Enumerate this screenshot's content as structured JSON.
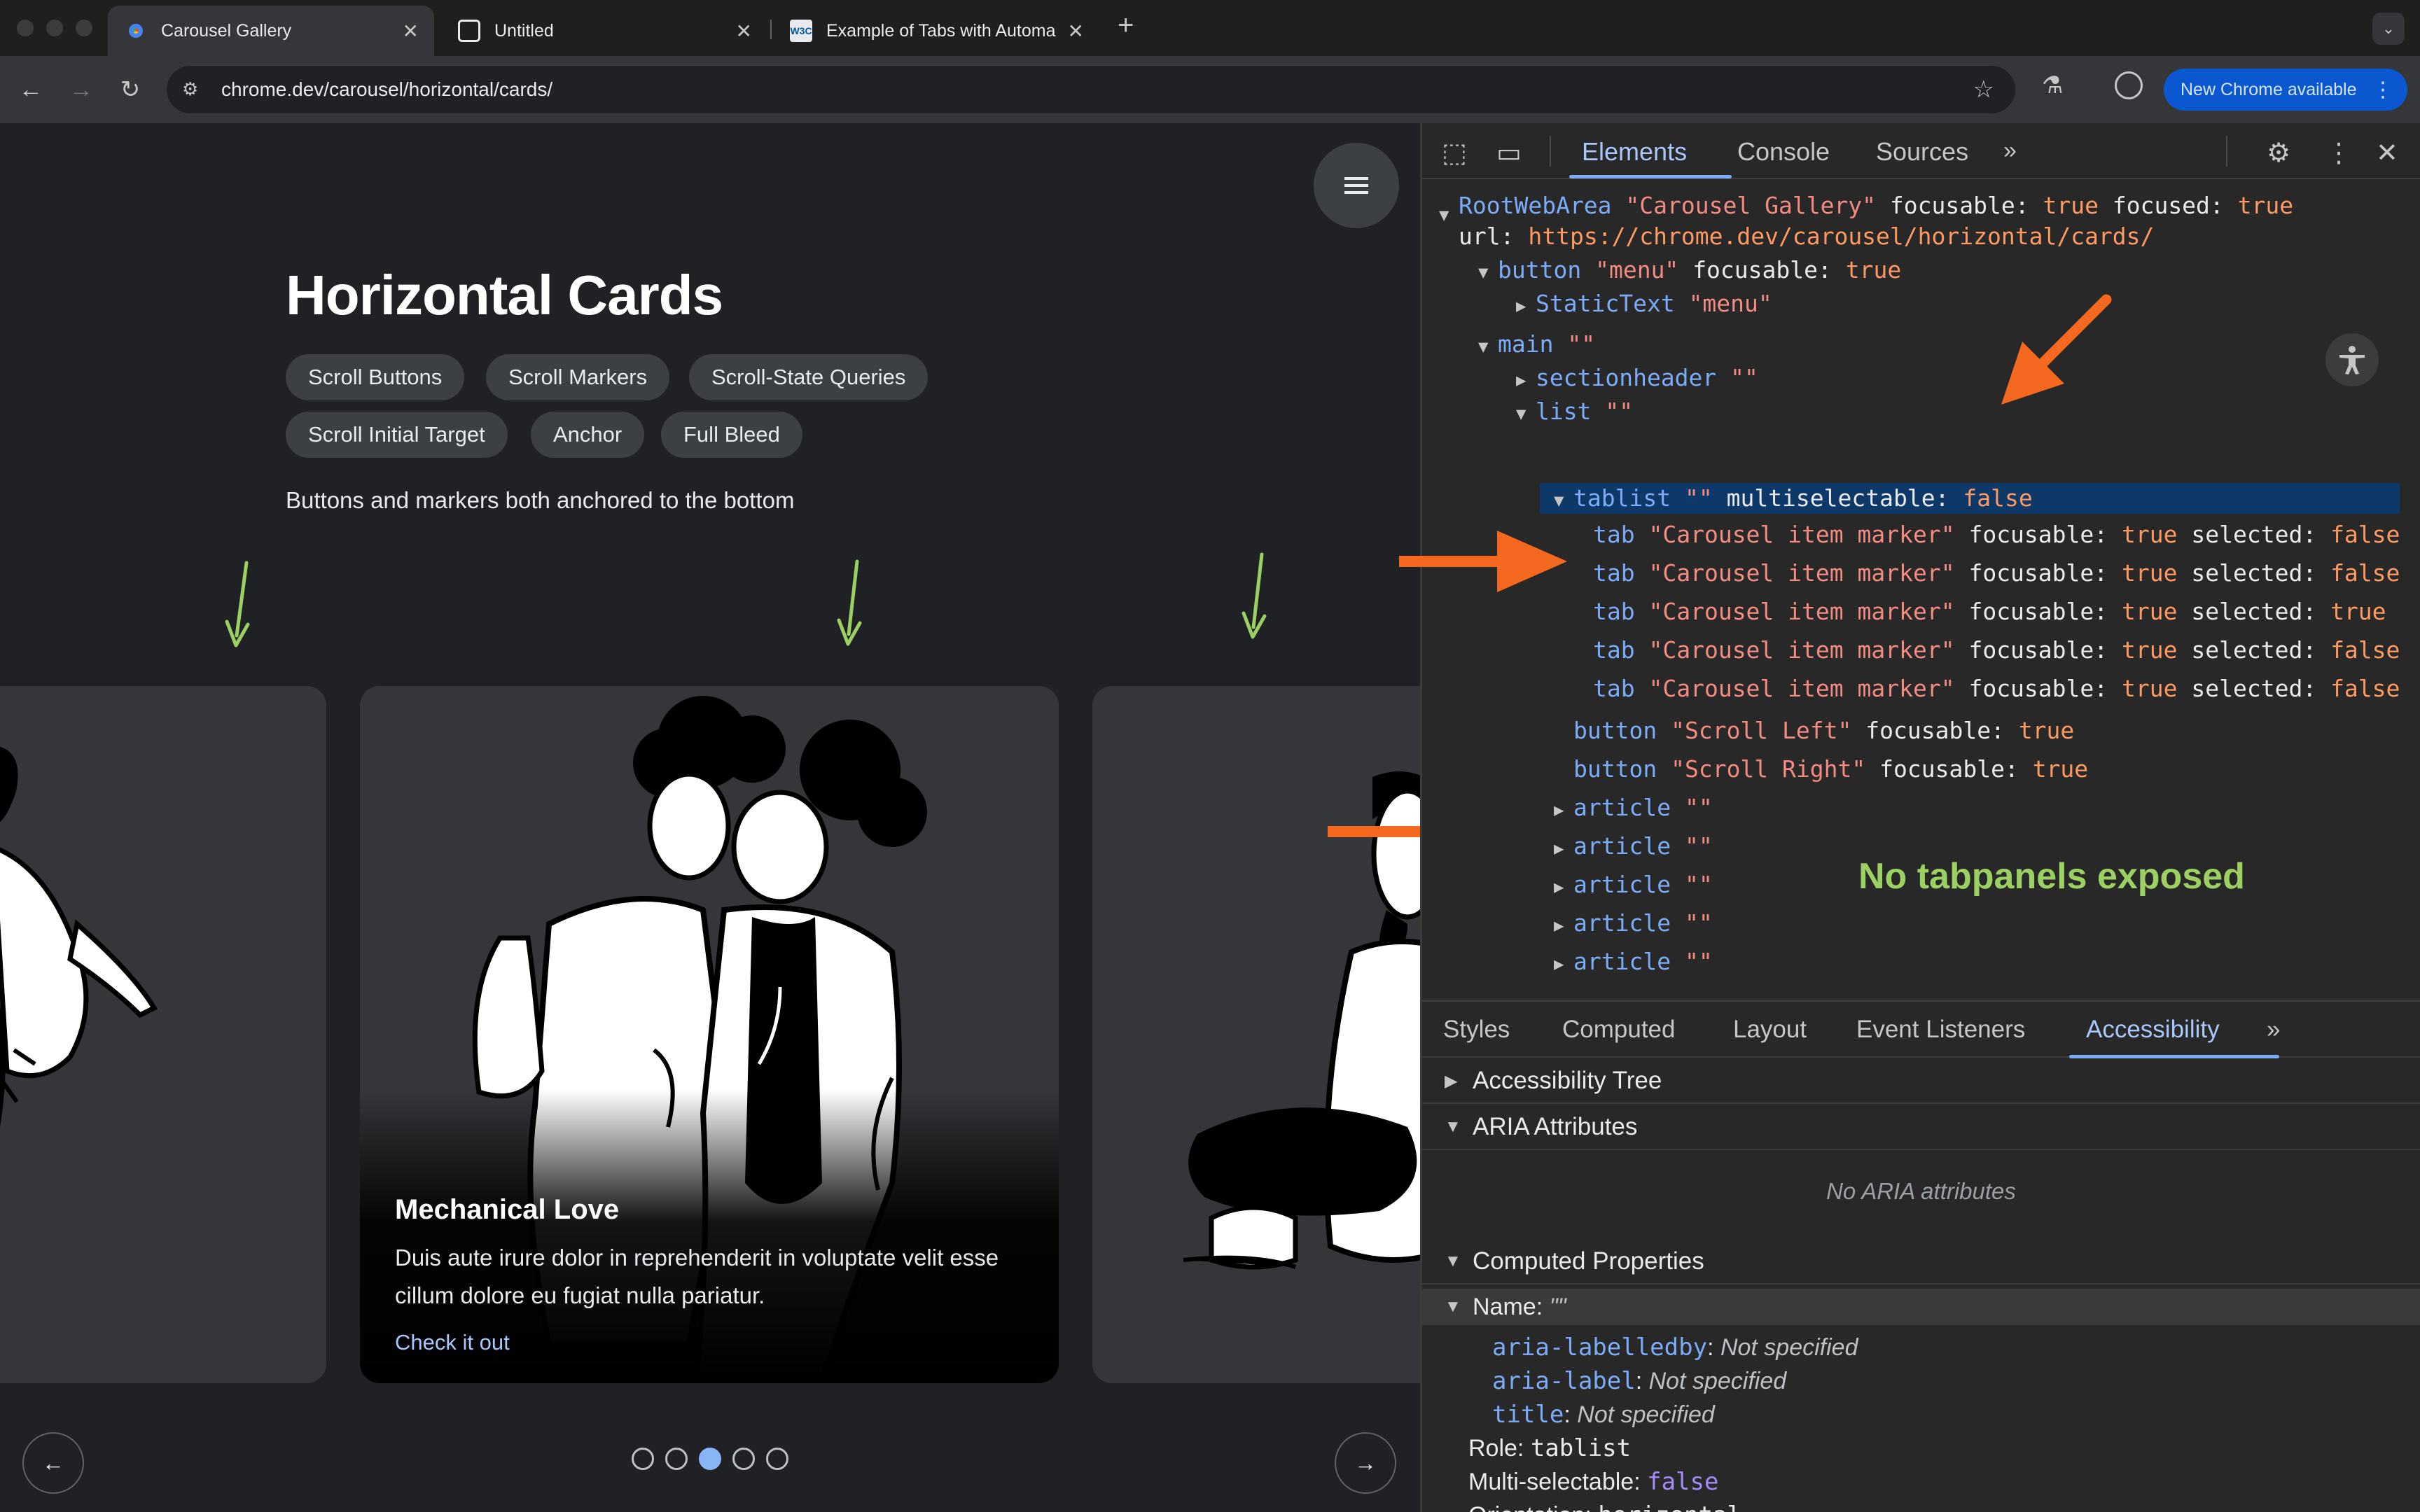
{
  "browser": {
    "tabs": [
      {
        "title": "Carousel Gallery",
        "active": true
      },
      {
        "title": "Untitled",
        "active": false
      },
      {
        "title": "Example of Tabs with Automa",
        "active": false
      }
    ],
    "url": "chrome.dev/carousel/horizontal/cards/",
    "update_label": "New Chrome available"
  },
  "page": {
    "title": "Horizontal Cards",
    "chips": [
      "Scroll Buttons",
      "Scroll Markers",
      "Scroll-State Queries",
      "Scroll Initial Target",
      "Anchor",
      "Full Bleed"
    ],
    "description": "Buttons and markers both anchored to the bottom",
    "card": {
      "title": "Mechanical Love",
      "body": "Duis aute irure dolor in reprehenderit in voluptate velit esse cillum dolore eu fugiat nulla pariatur.",
      "link": "Check it out"
    },
    "markers": [
      false,
      false,
      true,
      false,
      false
    ]
  },
  "devtools": {
    "tabs": [
      "Elements",
      "Console",
      "Sources"
    ],
    "tree": {
      "root_role": "RootWebArea",
      "root_name": "\"Carousel Gallery\"",
      "focusable": "focusable:",
      "true_val": "true",
      "false_val": "false",
      "focused": "focused:",
      "url_key": "url:",
      "url_val": "https://chrome.dev/carousel/horizontal/cards/",
      "button_role": "button",
      "menu_name": "\"menu\"",
      "static_text": "StaticText",
      "main_role": "main",
      "empty_name": "\"\"",
      "sectionheader": "sectionheader",
      "list_role": "list",
      "tablist_role": "tablist",
      "multiselectable": "multiselectable:",
      "tab_role": "tab",
      "tab_name": "\"Carousel item marker\"",
      "selected": "selected:",
      "tab_selected": [
        false,
        false,
        true,
        false,
        false
      ],
      "scroll_left": "\"Scroll Left\"",
      "scroll_right": "\"Scroll Right\"",
      "article_role": "article",
      "article_count": 5
    },
    "annotation": "No tabpanels exposed",
    "lower_tabs": [
      "Styles",
      "Computed",
      "Layout",
      "Event Listeners",
      "Accessibility"
    ],
    "sections": {
      "tree": "Accessibility Tree",
      "aria": "ARIA Attributes",
      "no_aria": "No ARIA attributes",
      "computed": "Computed Properties"
    },
    "props": {
      "name_label": "Name:",
      "name_val": "\"\"",
      "labelledby_key": "aria-labelledby",
      "label_key": "aria-label",
      "title_key": "title",
      "not_specified": "Not specified",
      "role_label": "Role:",
      "role_val": "tablist",
      "multi_label": "Multi-selectable:",
      "multi_val": "false",
      "orient_label": "Orientation:",
      "orient_val": "horizontal"
    }
  },
  "colors": {
    "accent": "#8ab4f8",
    "annotation_green": "#9cd062",
    "annotation_orange": "#f4691f"
  }
}
